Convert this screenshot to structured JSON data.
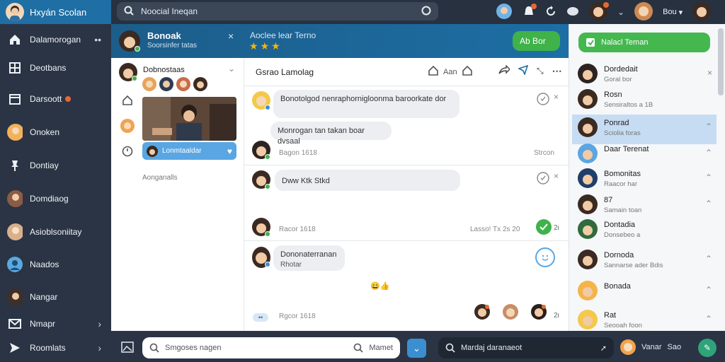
{
  "app": {
    "title": "Hxyán Scolan"
  },
  "search": {
    "placeholder": "Noocial Ineqan"
  },
  "topbar": {
    "menu_label": "Bou"
  },
  "nav": {
    "items": [
      {
        "label": "Dalamorogan"
      },
      {
        "label": "Deotbans"
      },
      {
        "label": "Darsoott"
      },
      {
        "label": "Onoken"
      },
      {
        "label": "Dontiay"
      },
      {
        "label": "Domdiaog"
      },
      {
        "label": "Asioblsoniitay"
      },
      {
        "label": "Naados"
      },
      {
        "label": "Nangar"
      },
      {
        "label": "Nmapr"
      },
      {
        "label": "Roomlats"
      }
    ]
  },
  "header": {
    "name": "Bonoak",
    "subtitle": "Soorsinfer tatas",
    "channel": "Aoclee lear Terno",
    "rating": 3,
    "action_label": "Ab Bor"
  },
  "sublist": {
    "title": "Dobnostaas",
    "highlight_label": "Lonmtaaldar",
    "footer": "Aonganalls"
  },
  "chat": {
    "title": "Gsrao Lamolag",
    "tools_label": "Aan",
    "messages": [
      {
        "text": "Bonotolgod nenraphornigloonma baroorkate dor"
      },
      {
        "text": "Monrogan tan takan boar dvsaal"
      },
      {
        "time": "Bagon 1618",
        "tag": "Strcon"
      },
      {
        "text": "Dww Ktk Stkd"
      },
      {
        "time": "Racor 1618",
        "tag": "Lasso! Tx 2s  20"
      },
      {
        "text": "Dononaterranan",
        "subtext": "Rhotar"
      },
      {
        "time": "Rgcor 1618"
      }
    ]
  },
  "right": {
    "cta_label": "Nalacl Teman",
    "contacts": [
      {
        "name": "Dordedait",
        "sub": "Goral bor",
        "chev": "x"
      },
      {
        "name": "Rosn",
        "sub": "Sensiraltos a 1B",
        "chev": ""
      },
      {
        "name": "Ponrad",
        "sub": "Sciolia foras",
        "chev": "^"
      },
      {
        "name": "Daar Terenat",
        "sub": "",
        "chev": "^"
      },
      {
        "name": "Bomonitas",
        "sub": "Raacor har",
        "chev": "^"
      },
      {
        "name": "87",
        "sub": "Samain toan",
        "chev": "^"
      },
      {
        "name": "Dontadia",
        "sub": "Donsebeo a",
        "chev": ""
      },
      {
        "name": "Dornoda",
        "sub": "Sannarse ader Bdis",
        "chev": "^"
      },
      {
        "name": "Bonada",
        "sub": "",
        "chev": "^"
      },
      {
        "name": "Rat",
        "sub": "Seooah foon",
        "chev": "^"
      }
    ]
  },
  "bottombar": {
    "compose_placeholder": "Smgoses nagen",
    "compose_action": "Mamet",
    "search_label": "Mardaj daranaeot",
    "user_label": "Vanar",
    "user_extra": "Sao"
  },
  "colors": {
    "accent": "#1d6ea4",
    "green": "#3fb24a",
    "dark": "#2a3444"
  }
}
